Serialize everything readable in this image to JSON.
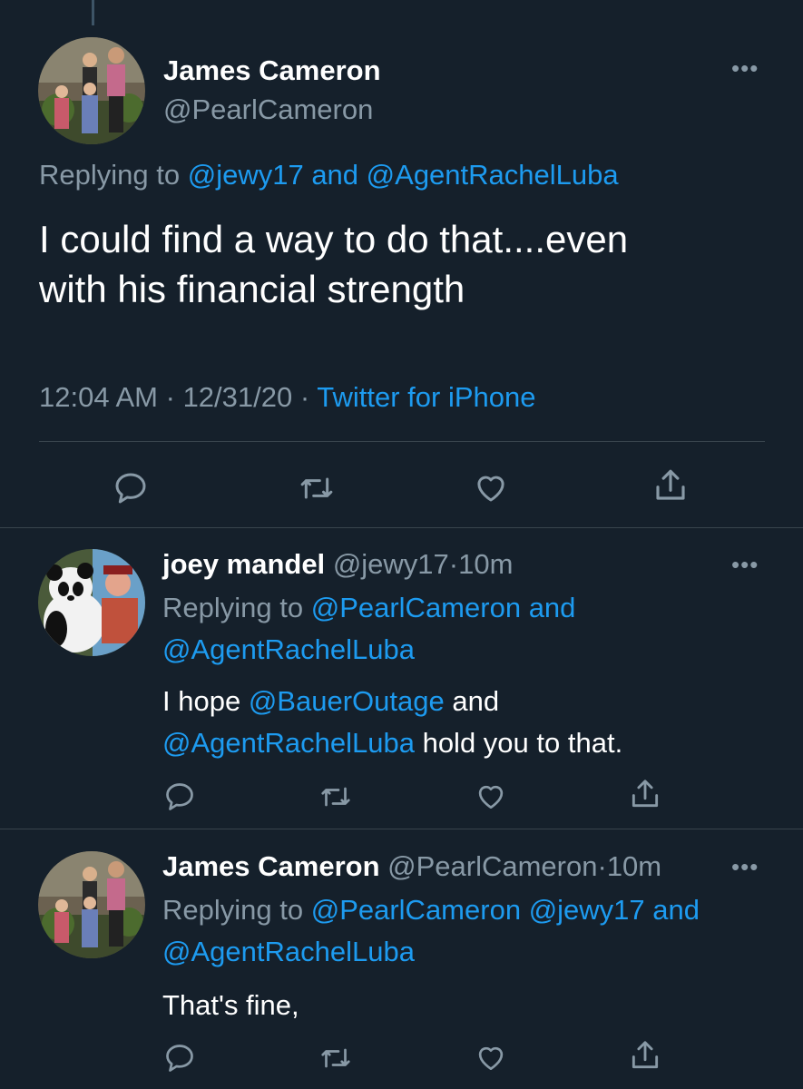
{
  "main_tweet": {
    "display_name": "James Cameron",
    "handle": "@PearlCameron",
    "replying_prefix": "Replying to",
    "replying_to_1": "@jewy17",
    "replying_and": "and",
    "replying_to_2": "@AgentRachelLuba",
    "text_line1": "I could find a way to do that....even",
    "text_line2": "with his financial strength",
    "time": "12:04 AM",
    "date": "12/31/20",
    "sep": "·",
    "source": "Twitter for iPhone"
  },
  "reply1": {
    "display_name": "joey mandel",
    "handle": "@jewy17",
    "sep": "·",
    "age": "10m",
    "replying_prefix": "Replying to",
    "replying_to_1": "@PearlCameron",
    "replying_and": "and",
    "replying_to_2": "@AgentRachelLuba",
    "text_a": "I hope",
    "mention_1": "@BauerOutage",
    "text_b": "and",
    "mention_2": "@AgentRachelLuba",
    "text_c": "hold you to that."
  },
  "reply2": {
    "display_name": "James Cameron",
    "handle": "@PearlCameron",
    "sep": "·",
    "age": "10m",
    "replying_prefix": "Replying to",
    "replying_to_1": "@PearlCameron",
    "replying_to_2": "@jewy17",
    "replying_and": "and",
    "replying_to_3": "@AgentRachelLuba",
    "text": "That's fine,"
  },
  "more_glyph": "•••",
  "colors": {
    "background": "#15202b",
    "accent": "#1d9bf0",
    "secondary": "#8899a6",
    "divider": "#38444d"
  },
  "icons": [
    "reply-icon",
    "retweet-icon",
    "like-icon",
    "share-icon",
    "more-icon"
  ]
}
